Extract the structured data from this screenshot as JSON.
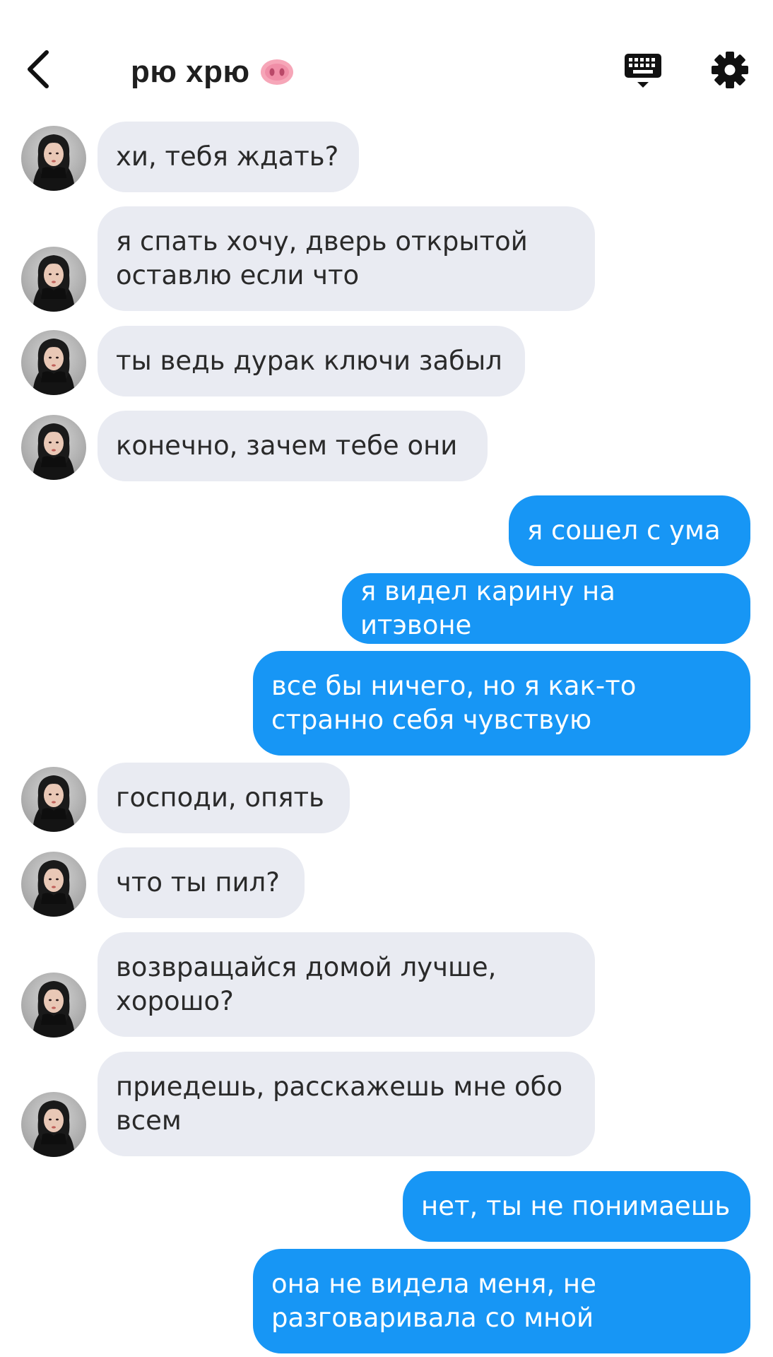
{
  "header": {
    "title": "рю хрю",
    "title_emoji_icon": "pig-nose-icon",
    "back_icon": "chevron-left-icon",
    "keyboard_icon": "keyboard-icon",
    "settings_icon": "gear-icon"
  },
  "colors": {
    "incoming_bubble": "#e9ebf2",
    "outgoing_bubble": "#1796f5",
    "incoming_text": "#2a2a2a",
    "outgoing_text": "#ffffff"
  },
  "messages": [
    {
      "from": "them",
      "text": "хи, тебя ждать?"
    },
    {
      "from": "them",
      "text": "я спать хочу, дверь открытой\nоставлю если что"
    },
    {
      "from": "them",
      "text": "ты ведь дурак ключи забыл"
    },
    {
      "from": "them",
      "text": "конечно, зачем тебе они"
    },
    {
      "from": "me",
      "text": "я сошел с ума"
    },
    {
      "from": "me",
      "text": "я видел карину на итэвоне"
    },
    {
      "from": "me",
      "text": "все бы ничего, но я как-то\nстранно себя чувствую"
    },
    {
      "from": "them",
      "text": "господи, опять"
    },
    {
      "from": "them",
      "text": "что ты пил?"
    },
    {
      "from": "them",
      "text": "возвращайся домой лучше,\nхорошо?"
    },
    {
      "from": "them",
      "text": "приедешь, расскажешь мне обо\nвсем"
    },
    {
      "from": "me",
      "text": "нет, ты не понимаешь"
    },
    {
      "from": "me",
      "text": "она не видела меня, не\nразговаривала со мной"
    }
  ]
}
